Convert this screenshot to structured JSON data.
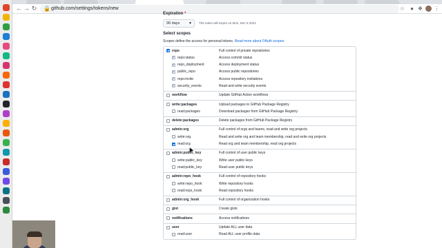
{
  "browser": {
    "url": "github.com/settings/tokens/new"
  },
  "form": {
    "expiration_label": "Expiration",
    "required_mark": "*",
    "expiration_value": "90 days",
    "expiration_note": "The token will expire on Mon, Dec 6 2021",
    "scopes_title": "Select scopes",
    "scopes_desc": "Scopes define the access for personal tokens.",
    "scopes_link": "Read more about OAuth scopes."
  },
  "scopes": [
    {
      "name": "repo",
      "desc": "Full control of private repositories",
      "checked": true,
      "children": [
        {
          "name": "repo:status",
          "desc": "Access commit status",
          "checked": true,
          "disabled": true
        },
        {
          "name": "repo_deployment",
          "desc": "Access deployment status",
          "checked": true,
          "disabled": true
        },
        {
          "name": "public_repo",
          "desc": "Access public repositories",
          "checked": true,
          "disabled": true
        },
        {
          "name": "repo:invite",
          "desc": "Access repository invitations",
          "checked": true,
          "disabled": true
        },
        {
          "name": "security_events",
          "desc": "Read and write security events",
          "checked": true,
          "disabled": true
        }
      ]
    },
    {
      "name": "workflow",
      "desc": "Update GitHub Action workflows",
      "checked": false,
      "children": []
    },
    {
      "name": "write:packages",
      "desc": "Upload packages to GitHub Package Registry",
      "checked": false,
      "children": [
        {
          "name": "read:packages",
          "desc": "Download packages from GitHub Package Registry",
          "checked": false
        }
      ]
    },
    {
      "name": "delete:packages",
      "desc": "Delete packages from GitHub Package Registry",
      "checked": false,
      "children": []
    },
    {
      "name": "admin:org",
      "desc": "Full control of orgs and teams, read and write org projects",
      "checked": false,
      "children": [
        {
          "name": "write:org",
          "desc": "Read and write org and team membership, read and write org projects",
          "checked": false
        },
        {
          "name": "read:org",
          "desc": "Read org and team membership, read org projects",
          "checked": true
        }
      ]
    },
    {
      "name": "admin:public_key",
      "desc": "Full control of user public keys",
      "checked": false,
      "children": [
        {
          "name": "write:public_key",
          "desc": "Write user public keys",
          "checked": false
        },
        {
          "name": "read:public_key",
          "desc": "Read user public keys",
          "checked": false
        }
      ]
    },
    {
      "name": "admin:repo_hook",
      "desc": "Full control of repository hooks",
      "checked": false,
      "children": [
        {
          "name": "write:repo_hook",
          "desc": "Write repository hooks",
          "checked": false
        },
        {
          "name": "read:repo_hook",
          "desc": "Read repository hooks",
          "checked": false
        }
      ]
    },
    {
      "name": "admin:org_hook",
      "desc": "Full control of organization hooks",
      "checked": false,
      "children": []
    },
    {
      "name": "gist",
      "desc": "Create gists",
      "checked": false,
      "children": []
    },
    {
      "name": "notifications",
      "desc": "Access notifications",
      "checked": false,
      "children": []
    },
    {
      "name": "user",
      "desc": "Update ALL user data",
      "checked": false,
      "children": [
        {
          "name": "read:user",
          "desc": "Read ALL user profile data",
          "checked": false
        }
      ]
    }
  ],
  "colors": {
    "accent": "#0969da",
    "required": "#cf222e"
  },
  "icons": {
    "back": "arrow-left-icon",
    "forward": "arrow-right-icon",
    "reload": "reload-icon",
    "lock": "lock-icon",
    "star": "star-icon",
    "extensions": "puzzle-icon",
    "menu": "kebab-menu-icon"
  }
}
